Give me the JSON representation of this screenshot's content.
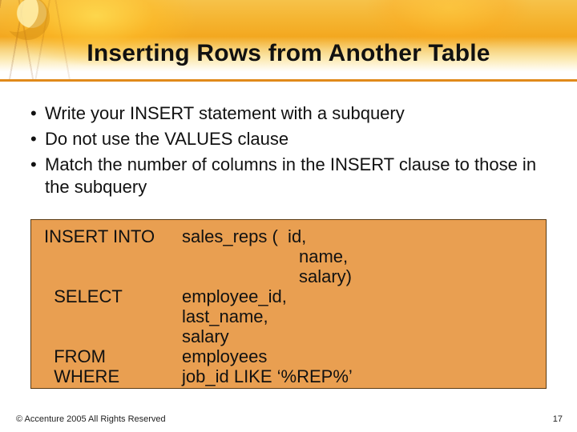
{
  "title": "Inserting Rows from Another Table",
  "bullets": [
    "Write your INSERT statement with a subquery",
    "Do not use the VALUES clause",
    "Match the number of columns in the INSERT clause to those in the subquery"
  ],
  "code": {
    "rows": [
      {
        "kw": "INSERT INTO",
        "arg": "sales_reps (  id,"
      },
      {
        "kw": "",
        "arg": "name,",
        "indent": 2
      },
      {
        "kw": "",
        "arg": "salary)",
        "indent": 2
      },
      {
        "kw": "  SELECT",
        "arg": "employee_id,"
      },
      {
        "kw": "",
        "arg": "last_name,"
      },
      {
        "kw": "",
        "arg": "salary"
      },
      {
        "kw": "  FROM",
        "arg": "employees"
      },
      {
        "kw": "  WHERE",
        "arg": "job_id LIKE ‘%REP%’"
      }
    ]
  },
  "footer": "© Accenture 2005 All Rights Reserved",
  "page": "17"
}
